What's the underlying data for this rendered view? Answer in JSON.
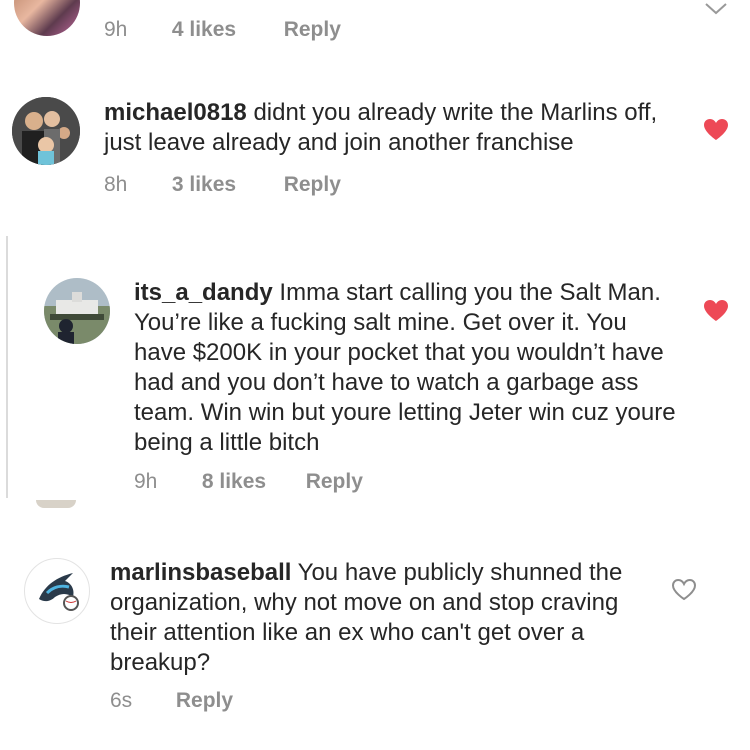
{
  "comments": [
    {
      "time": "9h",
      "likes": "4 likes",
      "reply": "Reply"
    },
    {
      "username": "michael0818",
      "text": "didnt you already write the Marlins off, just leave already and join another franchise",
      "time": "8h",
      "likes": "3 likes",
      "reply": "Reply",
      "liked": true
    },
    {
      "username": "its_a_dandy",
      "text": "Imma start calling you the Salt Man. You’re like a fucking salt mine. Get over it. You have $200K in your pocket that you wouldn’t have had and you don’t have to watch a garbage ass team. Win win but youre letting Jeter win cuz youre being a little bitch",
      "time": "9h",
      "likes": "8 likes",
      "reply": "Reply",
      "liked": true
    },
    {
      "username": "marlinsbaseball",
      "text": "You have publicly shunned the organization, why not move on and stop craving their attention like an ex who can't get over a breakup?",
      "time": "6s",
      "reply": "Reply",
      "liked": false
    }
  ],
  "colors": {
    "heart_liked": "#ed4956",
    "meta_gray": "#8e8e8e",
    "text": "#262626"
  }
}
